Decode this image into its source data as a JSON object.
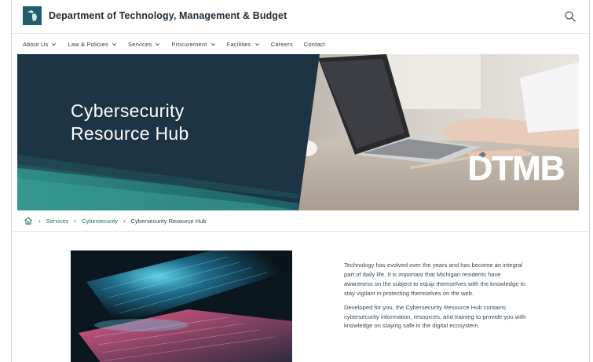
{
  "header": {
    "site_title": "Department of Technology, Management & Budget"
  },
  "nav": {
    "items": [
      {
        "label": "About Us",
        "has_dropdown": true
      },
      {
        "label": "Law & Policies",
        "has_dropdown": true
      },
      {
        "label": "Services",
        "has_dropdown": true
      },
      {
        "label": "Procurement",
        "has_dropdown": true
      },
      {
        "label": "Facilities",
        "has_dropdown": true
      },
      {
        "label": "Careers",
        "has_dropdown": false
      },
      {
        "label": "Contact",
        "has_dropdown": false
      }
    ]
  },
  "hero": {
    "title_line1": "Cybersecurity",
    "title_line2": "Resource Hub",
    "logo_text": "DTMB"
  },
  "breadcrumb": {
    "items": [
      "Services",
      "Cybersecurity"
    ],
    "current": "Cybersecurity Resource Hub"
  },
  "content": {
    "paragraph1": "Technology has evolved over the years and has become an integral part of daily life. It is important that Michigan residents have awareness on the subject to equip themselves with the knowledge to stay vigilant in protecting themselves on the web.",
    "paragraph2": "Developed for you, the Cybersecurity Resource Hub contains cybersecurity information, resources, and training to provide you with knowledge on staying safe in the digital ecosystem."
  },
  "colors": {
    "hero_panel": "#1c3443",
    "accent_teal": "#1b6f6a",
    "logo_bg": "#1f5e6b"
  }
}
